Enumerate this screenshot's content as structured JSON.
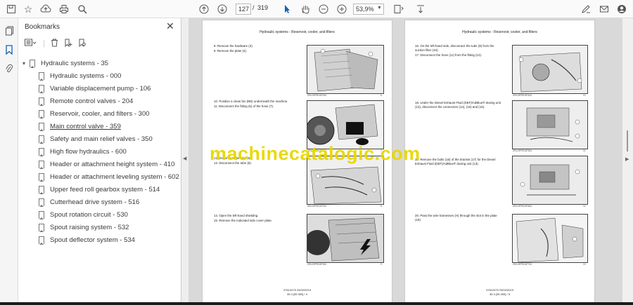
{
  "toolbar": {
    "page_current": "127",
    "page_separator": "/",
    "page_total": "319",
    "zoom": "53,9%",
    "icons": [
      "save-icon",
      "bookmark-star-icon",
      "upload-icon",
      "print-icon",
      "zoom-search-icon",
      "arrow-up-icon",
      "arrow-down-icon",
      "select-cursor-icon",
      "hand-icon",
      "zoom-out-icon",
      "zoom-in-icon",
      "fit-page-icon",
      "scroll-mode-icon",
      "pen-sign-icon",
      "mail-icon",
      "account-icon"
    ]
  },
  "sidebar": {
    "title": "Bookmarks",
    "items": [
      {
        "label": "Hydraulic systems - 35",
        "parent": true
      },
      {
        "label": "Hydraulic systems - 000"
      },
      {
        "label": "Variable displacement pump - 106"
      },
      {
        "label": "Remote control valves - 204"
      },
      {
        "label": "Reservoir, cooler, and filters - 300"
      },
      {
        "label": "Main control valve - 359",
        "underline": true
      },
      {
        "label": "Safety and main relief valves - 350"
      },
      {
        "label": "High flow hydraulics - 600"
      },
      {
        "label": "Header or attachment height system - 410"
      },
      {
        "label": "Header or attachment leveling system - 602"
      },
      {
        "label": "Upper feed roll gearbox system - 514"
      },
      {
        "label": "Cutterhead drive system - 516"
      },
      {
        "label": "Spout rotation circuit - 530"
      },
      {
        "label": "Spout raising system - 532"
      },
      {
        "label": "Spout deflector system - 534"
      }
    ]
  },
  "document": {
    "left_page": {
      "header": "Hydraulic systems - Reservoir, cooler, and filters",
      "steps": [
        "8.    Remove the hardware (3).",
        "9.    Remove the plate (4).",
        "10.   Position a clean bin (BN) underneath the machine.",
        "11.   Disconnect the fitting (5) of the hose (7).",
        "12.   Disconnect the tube (6).",
        "13.   Disconnect the tube (8).",
        "14.   Open the left-hand shielding.",
        "15.   Remove the indicated side cover plate."
      ],
      "fig_captions": [
        "ZEIL19FR01870A1",
        "ZEIL19FR01871A1",
        "ZEIL19FR01872A1",
        "ZEIL19FR01873A1"
      ],
      "fig_numbers": [
        "6",
        "7",
        "8",
        "9"
      ],
      "footer_line1": "47612475 23/02/2019",
      "footer_line2": "35.4 [35.300] / 4"
    },
    "right_page": {
      "header": "Hydraulic systems - Reservoir, cooler, and filters",
      "steps": [
        "16.   On the left-hand side, disconnect the tube (9) from the suction filter (10).",
        "17.   Disconnect the hose (11) from the fitting (12).",
        "18.   Under the Diesel Exhaust Fluid (DEF)/AdBlue® dosing unit (13), disconnect the connectors (14), (15) and (16).",
        "19.   Remove the bolts (16) of the bracket (17) for the Diesel Exhaust Fluid (DEF)/AdBlue® dosing unit (13).",
        "20.   Pass the wire harnesses (H) through the slot in the plate (19)."
      ],
      "fig_captions": [
        "ZEIL19FR01874A1",
        "ZEIL19FR01875A1",
        "ZEIL19FR01876A1",
        "ZEIL19FR01877A1"
      ],
      "fig_numbers": [
        "10",
        "11",
        "12",
        "13"
      ],
      "footer_line1": "47612475 23/02/2019",
      "footer_line2": "35.4 [35.300] / 5"
    },
    "watermark": "machinecatalogic.com"
  }
}
